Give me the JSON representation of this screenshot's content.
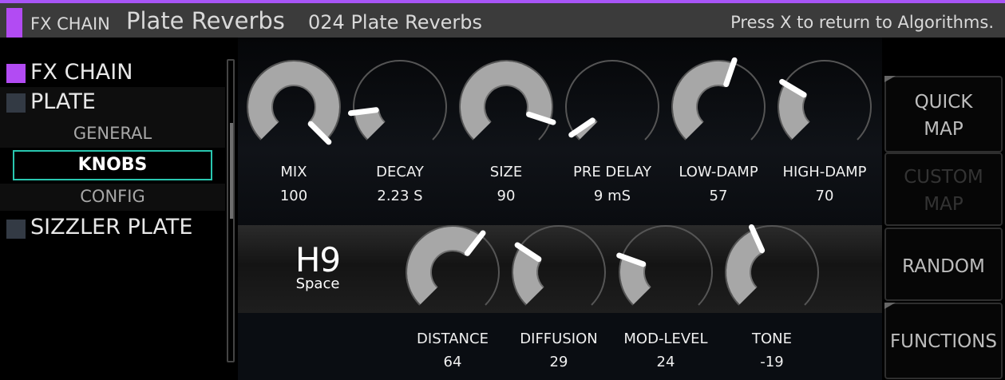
{
  "header": {
    "section": "FX CHAIN",
    "algorithm": "Plate Reverbs",
    "preset": "024 Plate Reverbs",
    "hint": "Press X to return to Algorithms.",
    "accent_color": "#a855f7"
  },
  "nav": {
    "fx_chain": "FX CHAIN",
    "plate": "PLATE",
    "general": "GENERAL",
    "knobs": "KNOBS",
    "config": "CONFIG",
    "sizzler_plate": "SIZZLER PLATE",
    "active_color": "#b24bf3",
    "inactive_color": "#333a44",
    "selection_color": "#29c7b0"
  },
  "knobs_row1": [
    {
      "label": "MIX",
      "value": "100",
      "level": 1.0
    },
    {
      "label": "DECAY",
      "value": "2.23 S",
      "level": 0.14
    },
    {
      "label": "SIZE",
      "value": "90",
      "level": 0.9
    },
    {
      "label": "PRE DELAY",
      "value": "9 mS",
      "level": 0.04
    },
    {
      "label": "LOW-DAMP",
      "value": "57",
      "level": 0.57
    },
    {
      "label": "HIGH-DAMP",
      "value": "70",
      "level": 0.28
    }
  ],
  "knobs_row2": [
    {
      "label": "DISTANCE",
      "value": "64",
      "level": 0.64
    },
    {
      "label": "DIFFUSION",
      "value": "29",
      "level": 0.29
    },
    {
      "label": "MOD-LEVEL",
      "value": "24",
      "level": 0.24
    },
    {
      "label": "TONE",
      "value": "-19",
      "level": 0.41
    }
  ],
  "logo": {
    "big": "H9",
    "small": "Space"
  },
  "buttons": {
    "quick_map": "QUICK\nMAP",
    "custom_map": "CUSTOM\nMAP",
    "random": "RANDOM",
    "functions": "FUNCTIONS"
  }
}
